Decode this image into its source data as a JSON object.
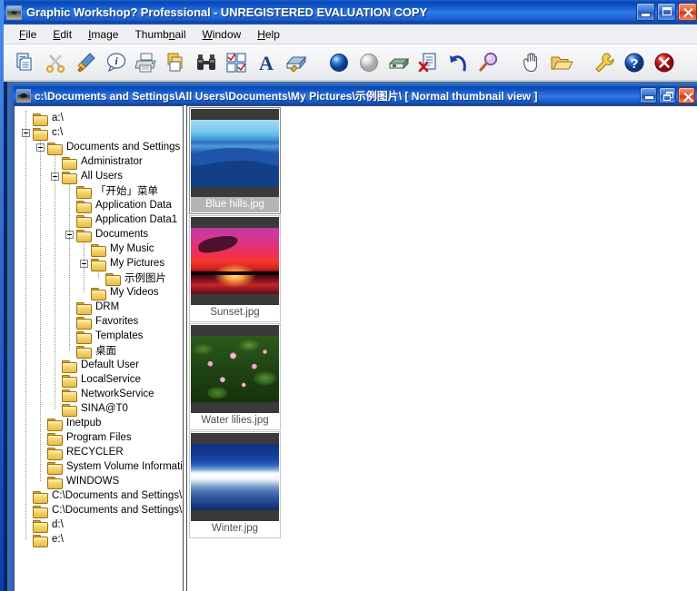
{
  "app": {
    "title": "Graphic Workshop? Professional - UNREGISTERED EVALUATION COPY",
    "icon": "photo-eye-icon",
    "caption_buttons": [
      {
        "name": "minimize",
        "label": "Minimize"
      },
      {
        "name": "maximize",
        "label": "Maximize"
      },
      {
        "name": "close",
        "label": "Close"
      }
    ]
  },
  "menubar": {
    "items": [
      {
        "name": "file",
        "pre": "",
        "accel": "F",
        "post": "ile"
      },
      {
        "name": "edit",
        "pre": "",
        "accel": "E",
        "post": "dit"
      },
      {
        "name": "image",
        "pre": "",
        "accel": "I",
        "post": "mage"
      },
      {
        "name": "thumbnail",
        "pre": "Thumb",
        "accel": "n",
        "post": "ail"
      },
      {
        "name": "window",
        "pre": "",
        "accel": "W",
        "post": "indow"
      },
      {
        "name": "help",
        "pre": "",
        "accel": "H",
        "post": "elp"
      }
    ]
  },
  "toolbar": {
    "buttons": [
      {
        "name": "copy-icon",
        "title": "Copy"
      },
      {
        "name": "cut-scissors-icon",
        "title": "Cut"
      },
      {
        "name": "paintbrush-icon",
        "title": "Paint"
      },
      {
        "name": "info-icon",
        "title": "Information"
      },
      {
        "name": "printer-icon",
        "title": "Print"
      },
      {
        "name": "duplicate-pages-icon",
        "title": "Duplicate"
      },
      {
        "name": "binoculars-icon",
        "title": "Find"
      },
      {
        "name": "select-all-checkboxes-icon",
        "title": "Select"
      },
      {
        "name": "text-a-icon",
        "title": "Text"
      },
      {
        "name": "scanner-icon",
        "title": "Scan"
      },
      {
        "name": "blue-sphere-icon",
        "title": "Color depth"
      },
      {
        "name": "gray-sphere-icon",
        "title": "Greyscale"
      },
      {
        "name": "green-disk-icon",
        "title": "Save to disk"
      },
      {
        "name": "delete-file-icon",
        "title": "Delete file"
      },
      {
        "name": "undo-arrow-icon",
        "title": "Undo"
      },
      {
        "name": "magnifier-icon",
        "title": "Zoom"
      },
      {
        "name": "hand-icon",
        "title": "Pan"
      },
      {
        "name": "open-folder-icon",
        "title": "Open folder"
      },
      {
        "name": "wrench-icon",
        "title": "Preferences"
      },
      {
        "name": "help-question-icon",
        "title": "Help"
      },
      {
        "name": "exit-close-icon",
        "title": "Exit"
      }
    ]
  },
  "document": {
    "title": "c:\\Documents and Settings\\All Users\\Documents\\My Pictures\\示例图片\\ [ Normal thumbnail view ]",
    "icon": "photo-eye-icon",
    "caption_buttons": [
      {
        "name": "minimize",
        "label": "Minimize"
      },
      {
        "name": "restore",
        "label": "Restore"
      },
      {
        "name": "close",
        "label": "Close"
      }
    ]
  },
  "tree": {
    "nodes": [
      {
        "label": "a:\\",
        "depth": 0,
        "expander": "none"
      },
      {
        "label": "c:\\",
        "depth": 0,
        "expander": "minus"
      },
      {
        "label": "Documents and Settings",
        "depth": 1,
        "expander": "minus"
      },
      {
        "label": "Administrator",
        "depth": 2,
        "expander": "none"
      },
      {
        "label": "All Users",
        "depth": 2,
        "expander": "minus"
      },
      {
        "label": "「开始」菜单",
        "depth": 3,
        "expander": "none"
      },
      {
        "label": "Application Data",
        "depth": 3,
        "expander": "none"
      },
      {
        "label": "Application Data1",
        "depth": 3,
        "expander": "none"
      },
      {
        "label": "Documents",
        "depth": 3,
        "expander": "minus"
      },
      {
        "label": "My Music",
        "depth": 4,
        "expander": "none"
      },
      {
        "label": "My Pictures",
        "depth": 4,
        "expander": "minus"
      },
      {
        "label": "示例图片",
        "depth": 5,
        "expander": "none"
      },
      {
        "label": "My Videos",
        "depth": 4,
        "expander": "none"
      },
      {
        "label": "DRM",
        "depth": 3,
        "expander": "none"
      },
      {
        "label": "Favorites",
        "depth": 3,
        "expander": "none"
      },
      {
        "label": "Templates",
        "depth": 3,
        "expander": "none"
      },
      {
        "label": "桌面",
        "depth": 3,
        "expander": "none"
      },
      {
        "label": "Default User",
        "depth": 2,
        "expander": "none"
      },
      {
        "label": "LocalService",
        "depth": 2,
        "expander": "none"
      },
      {
        "label": "NetworkService",
        "depth": 2,
        "expander": "none"
      },
      {
        "label": "SINA@T0",
        "depth": 2,
        "expander": "none"
      },
      {
        "label": "Inetpub",
        "depth": 1,
        "expander": "none"
      },
      {
        "label": "Program Files",
        "depth": 1,
        "expander": "none"
      },
      {
        "label": "RECYCLER",
        "depth": 1,
        "expander": "none"
      },
      {
        "label": "System Volume Information",
        "depth": 1,
        "expander": "none"
      },
      {
        "label": "WINDOWS",
        "depth": 1,
        "expander": "none"
      },
      {
        "label": "C:\\Documents and Settings\\S",
        "depth": 0,
        "expander": "none"
      },
      {
        "label": "C:\\Documents and Settings\\S",
        "depth": 0,
        "expander": "none"
      },
      {
        "label": "d:\\",
        "depth": 0,
        "expander": "none"
      },
      {
        "label": "e:\\",
        "depth": 0,
        "expander": "none"
      }
    ]
  },
  "thumbnails": {
    "items": [
      {
        "name": "blue-hills",
        "caption": "Blue hills.jpg",
        "art": "art-bluehills",
        "selected": true
      },
      {
        "name": "sunset",
        "caption": "Sunset.jpg",
        "art": "art-sunset",
        "selected": false
      },
      {
        "name": "water-lilies",
        "caption": "Water lilies.jpg",
        "art": "art-lilies",
        "selected": false
      },
      {
        "name": "winter",
        "caption": "Winter.jpg",
        "art": "art-winter",
        "selected": false
      }
    ]
  },
  "colors": {
    "titlebar_blue": "#0a48b5",
    "titlebar_light": "#3279e4",
    "close_red": "#cc3a18",
    "folder_yellow": "#e8bc42",
    "selection_gray": "#b4b4b4",
    "mdi_background": "#3a6ea5"
  }
}
